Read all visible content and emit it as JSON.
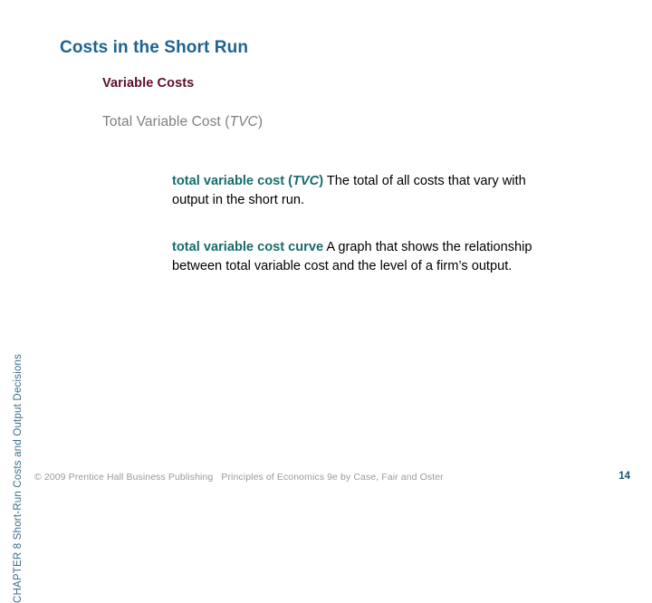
{
  "slide": {
    "title": "Costs in the Short Run",
    "sub_heading": "Variable Costs",
    "topic_line": {
      "text": "Total Variable Cost (",
      "italic": "TVC",
      "close": ")"
    },
    "definitions": [
      {
        "term": "total variable cost (",
        "term_italic": "TVC",
        "term_close": ")",
        "body": "The total of all costs that vary with output in the short run."
      },
      {
        "term": "total variable cost curve",
        "term_italic": "",
        "term_close": "",
        "body": "A graph that shows the relationship between total variable cost and the level of a firm’s output."
      }
    ]
  },
  "chapter_rail": {
    "text": "CHAPTER 8  Short-Run Costs and Output Decisions"
  },
  "footer": {
    "copyright": "© 2009 Prentice Hall Business Publishing",
    "book": "Principles of Economics 9e by Case, Fair and Oster",
    "page_number": "14"
  },
  "colors": {
    "title": "#1f6390",
    "sub_heading": "#5c0d28",
    "topic_line": "#808080",
    "definition_term": "#1a6b6b",
    "definition_body": "#000000",
    "chapter_rail": "#3c6e86",
    "footer": "#9a9a9a",
    "page_number": "#16566e",
    "background": "#ffffff"
  }
}
